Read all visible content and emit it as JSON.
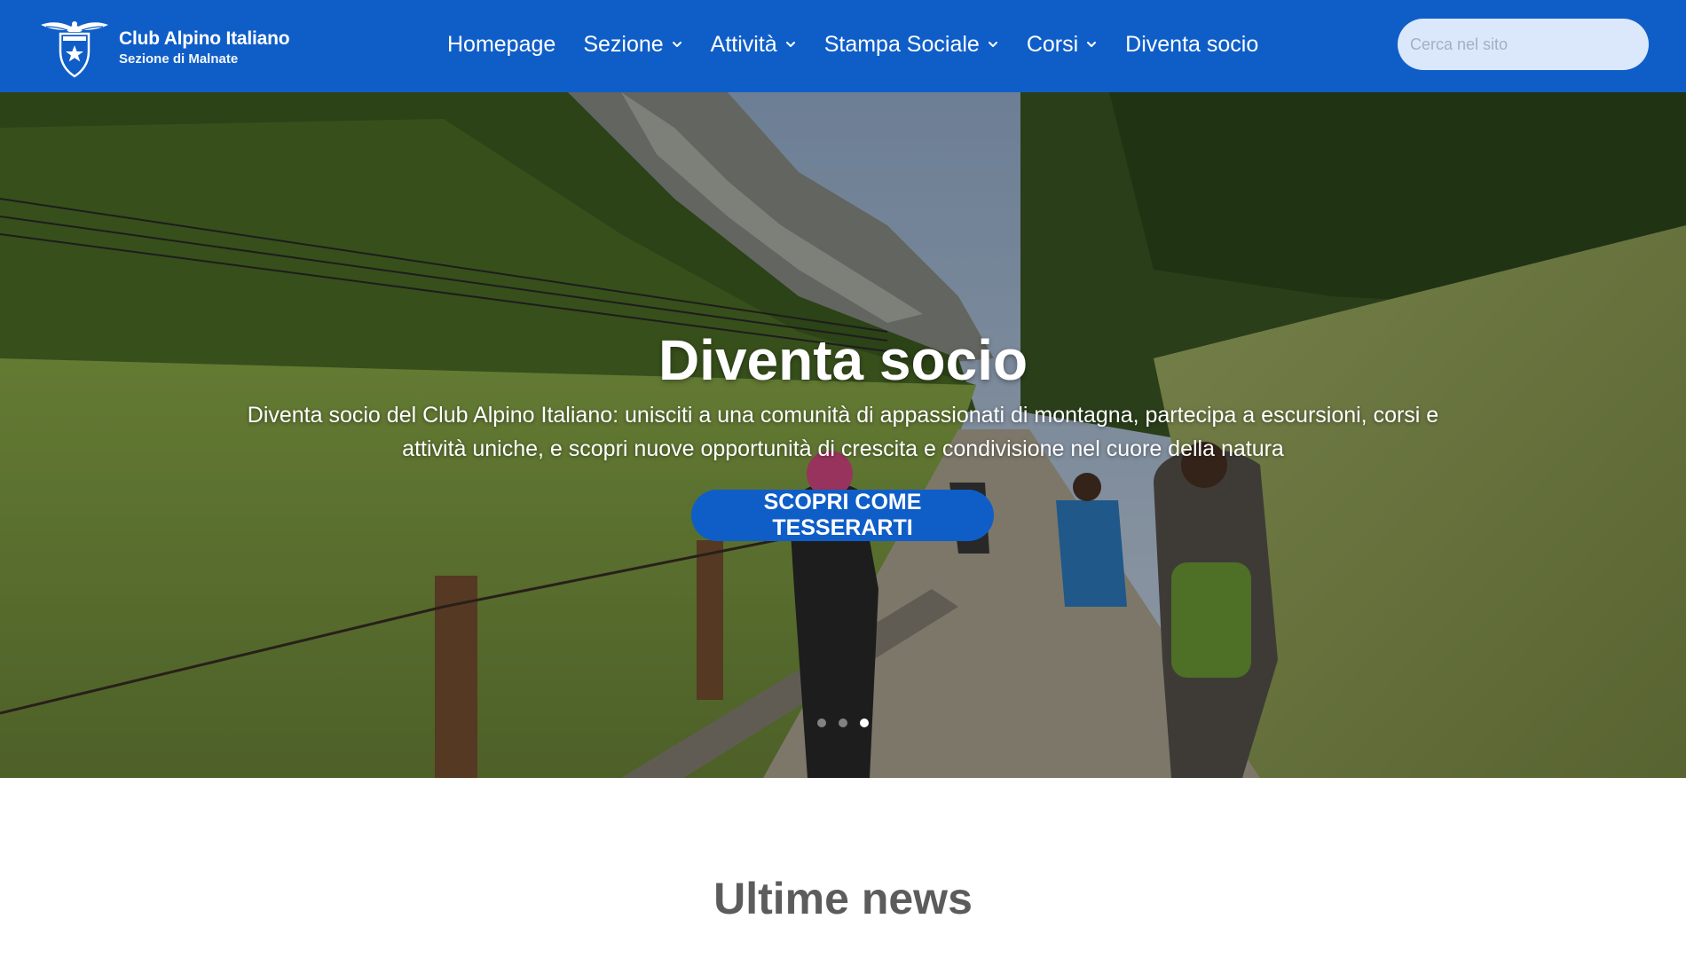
{
  "header": {
    "logo_title": "Club Alpino Italiano",
    "logo_subtitle": "Sezione di Malnate",
    "nav": [
      {
        "label": "Homepage",
        "has_dropdown": false
      },
      {
        "label": "Sezione",
        "has_dropdown": true
      },
      {
        "label": "Attività",
        "has_dropdown": true
      },
      {
        "label": "Stampa Sociale",
        "has_dropdown": true
      },
      {
        "label": "Corsi",
        "has_dropdown": true
      },
      {
        "label": "Diventa socio",
        "has_dropdown": false
      }
    ],
    "search_placeholder": "Cerca nel sito"
  },
  "hero": {
    "title": "Diventa socio",
    "text": "Diventa socio del Club Alpino Italiano: unisciti a una comunità di appassionati di montagna, partecipa a escursioni, corsi e attività uniche, e scopri nuove opportunità di crescita e condivisione nel cuore della natura",
    "cta_label": "SCOPRI COME TESSERARTI",
    "slides_total": 3,
    "active_slide": 3
  },
  "news": {
    "title": "Ultime news"
  },
  "colors": {
    "brand_blue": "#0f5ec8",
    "search_bg": "#dbe7fb",
    "heading_gray": "#5c5c5c"
  }
}
